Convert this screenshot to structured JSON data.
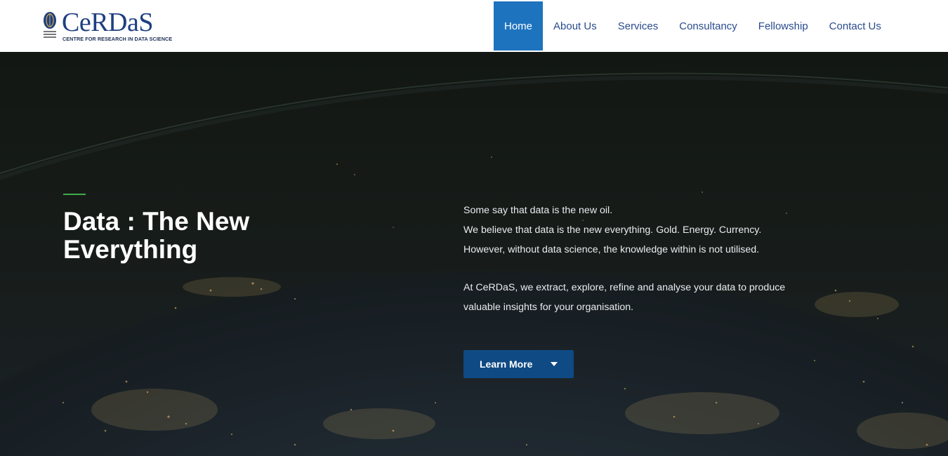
{
  "brand": {
    "name": "CeRDaS",
    "tagline": "CENTRE FOR RESEARCH IN DATA SCIENCE",
    "primary_color": "#1e3f80"
  },
  "nav": {
    "items": [
      {
        "label": "Home",
        "active": true
      },
      {
        "label": "About Us",
        "active": false
      },
      {
        "label": "Services",
        "active": false
      },
      {
        "label": "Consultancy",
        "active": false
      },
      {
        "label": "Fellowship",
        "active": false
      },
      {
        "label": "Contact Us",
        "active": false
      }
    ],
    "active_color": "#1e73be",
    "link_color": "#2a4b8d"
  },
  "hero": {
    "title": "Data : The New Everything",
    "paragraph1": [
      "Some say that data is the new oil.",
      "We believe that data is the new everything. Gold. Energy. Currency.",
      "However, without data science, the knowledge within is not utilised."
    ],
    "paragraph2": [
      "At CeRDaS, we extract, explore, refine and analyse your data to produce",
      "valuable insights for your organisation."
    ],
    "cta_label": "Learn More",
    "cta_icon": "caret-down-icon",
    "accent_color": "#3fae49",
    "cta_color": "#0f4a84"
  }
}
